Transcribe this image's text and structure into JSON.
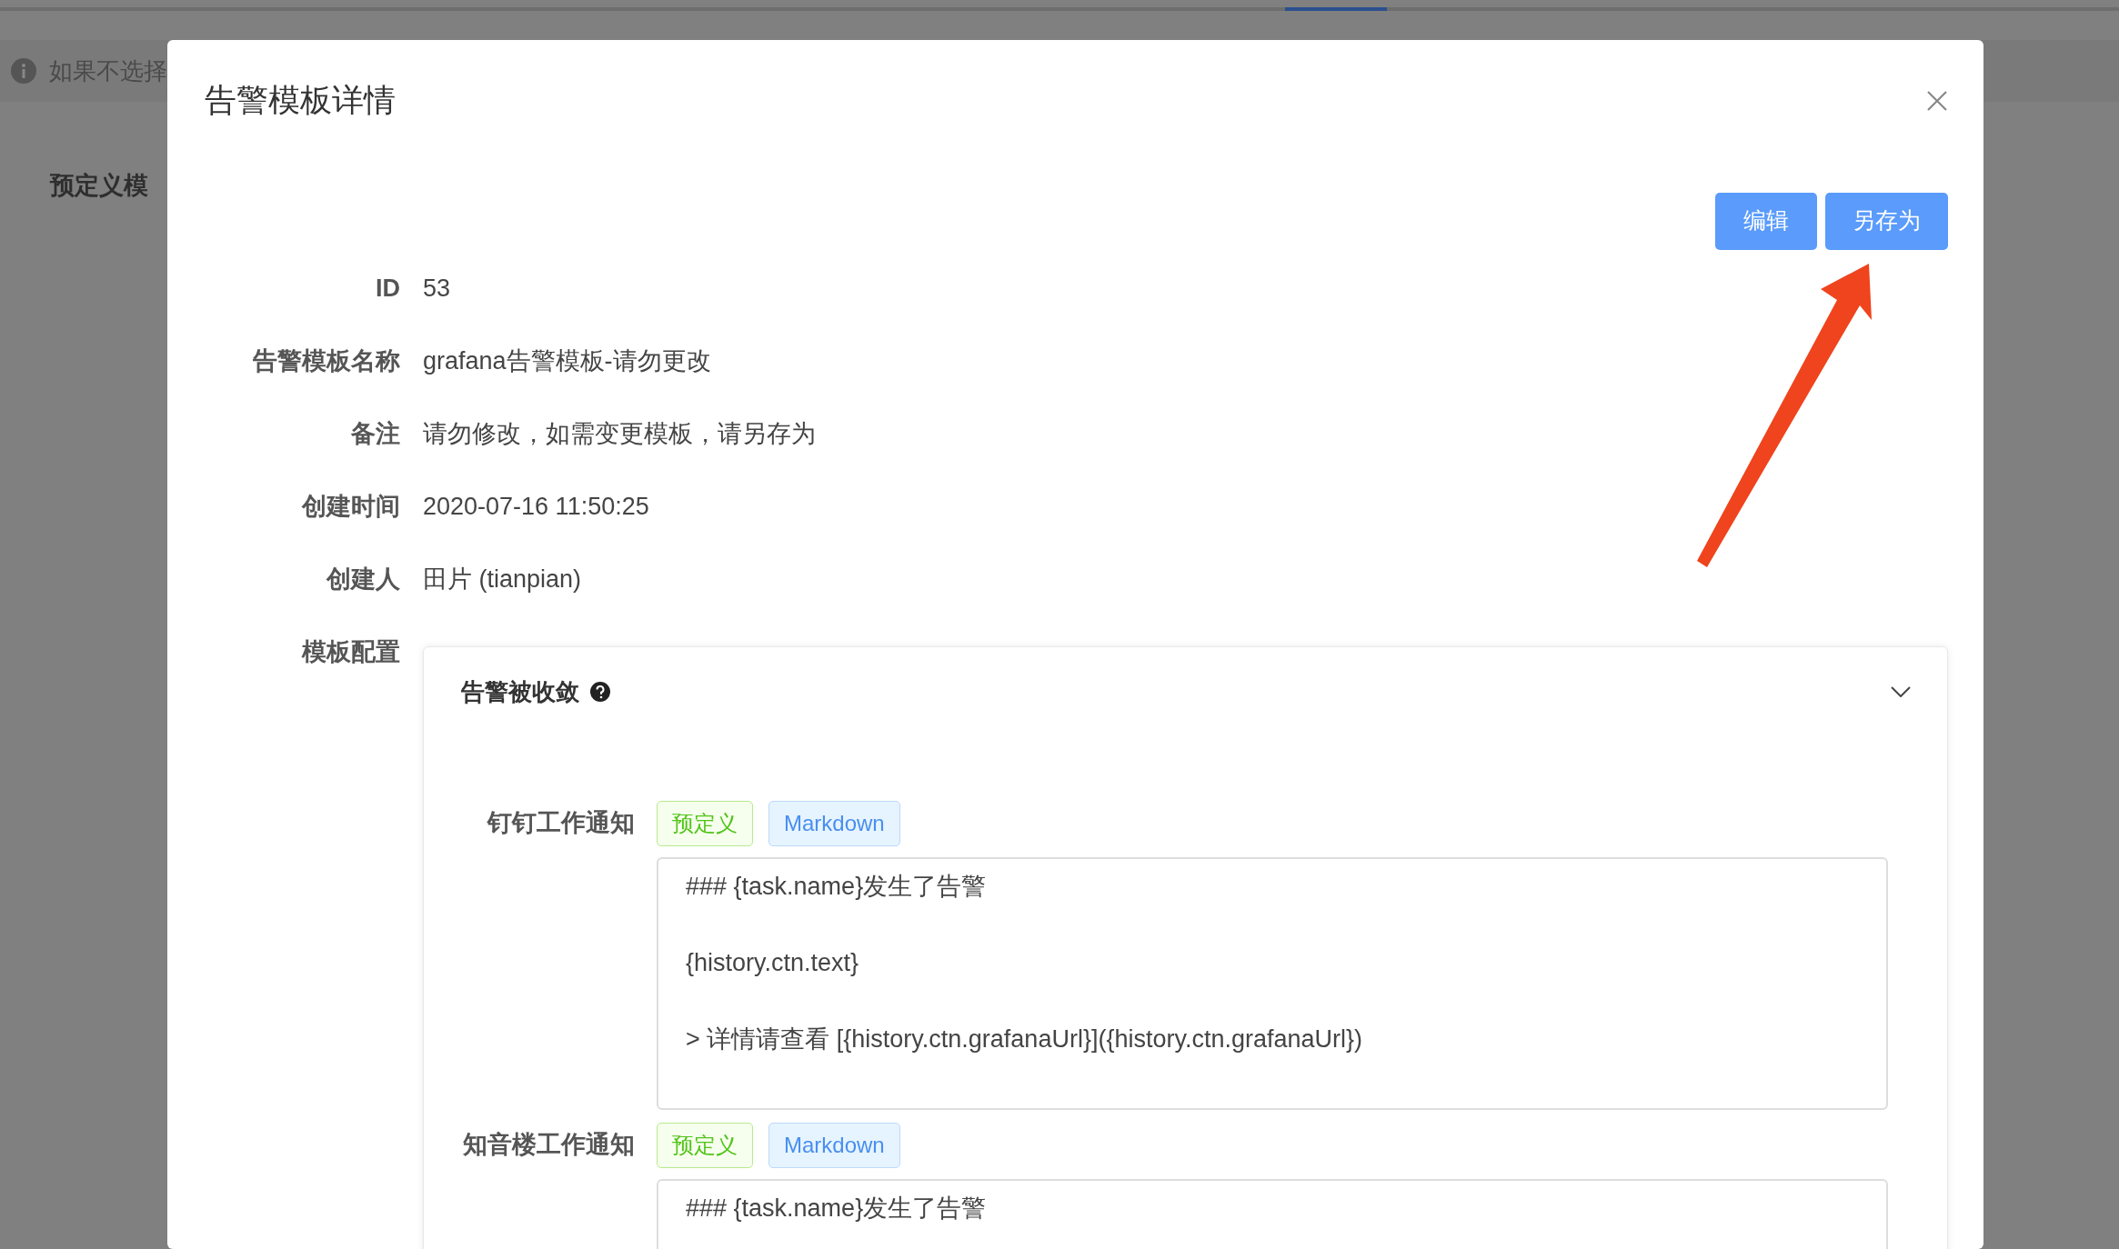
{
  "background": {
    "notice": "如果不选择",
    "section_title": "预定义模"
  },
  "modal": {
    "title": "告警模板详情",
    "buttons": [
      {
        "label": "编辑"
      },
      {
        "label": "另存为"
      }
    ],
    "fields": [
      {
        "label": "ID",
        "value": "53"
      },
      {
        "label": "告警模板名称",
        "value": "grafana告警模板-请勿更改"
      },
      {
        "label": "备注",
        "value": "请勿修改，如需变更模板，请另存为"
      },
      {
        "label": "创建时间",
        "value": "2020-07-16 11:50:25"
      },
      {
        "label": "创建人",
        "value": "田片 (tianpian)"
      }
    ],
    "config": {
      "label": "模板配置",
      "panel_title": "告警被收敛",
      "channels": [
        {
          "name": "钉钉工作通知",
          "tags": [
            {
              "label": "预定义",
              "kind": "source"
            },
            {
              "label": "Markdown",
              "kind": "format"
            }
          ],
          "content": "### {task.name}发生了告警\n\n{history.ctn.text}\n\n> 详情请查看 [{history.ctn.grafanaUrl}]({history.ctn.grafanaUrl})"
        },
        {
          "name": "知音楼工作通知",
          "tags": [
            {
              "label": "预定义",
              "kind": "source"
            },
            {
              "label": "Markdown",
              "kind": "format"
            }
          ],
          "content": "### {task.name}发生了告警"
        }
      ]
    }
  }
}
